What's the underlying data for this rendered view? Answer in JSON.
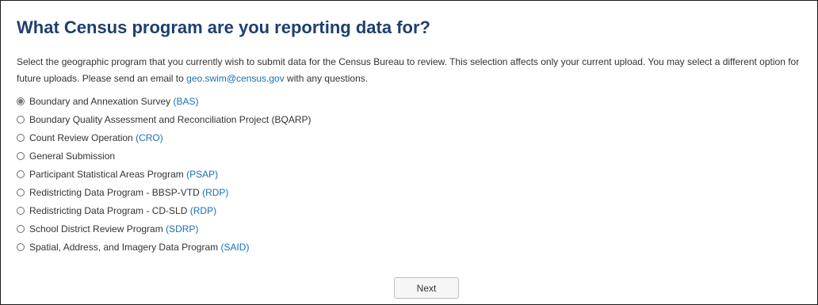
{
  "page": {
    "title": "What Census program are you reporting data for?",
    "description_part1": "Select the geographic program that you currently wish to submit data for the Census Bureau to review. This selection affects only your current upload. You may select a different option for future uploads. Please send an email to ",
    "email": "geo.swim@census.gov",
    "description_part2": " with any questions."
  },
  "options": [
    {
      "label": "Boundary and Annexation Survey ",
      "abbr": "(BAS)",
      "selected": true
    },
    {
      "label": "Boundary Quality Assessment and Reconciliation Project (BQARP)",
      "abbr": "",
      "selected": false
    },
    {
      "label": "Count Review Operation ",
      "abbr": "(CRO)",
      "selected": false
    },
    {
      "label": "General Submission",
      "abbr": "",
      "selected": false
    },
    {
      "label": "Participant Statistical Areas Program ",
      "abbr": "(PSAP)",
      "selected": false
    },
    {
      "label": "Redistricting Data Program - BBSP-VTD ",
      "abbr": "(RDP)",
      "selected": false
    },
    {
      "label": "Redistricting Data Program - CD-SLD ",
      "abbr": "(RDP)",
      "selected": false
    },
    {
      "label": "School District Review Program ",
      "abbr": "(SDRP)",
      "selected": false
    },
    {
      "label": "Spatial, Address, and Imagery Data Program ",
      "abbr": "(SAID)",
      "selected": false
    }
  ],
  "buttons": {
    "next_label": "Next"
  }
}
